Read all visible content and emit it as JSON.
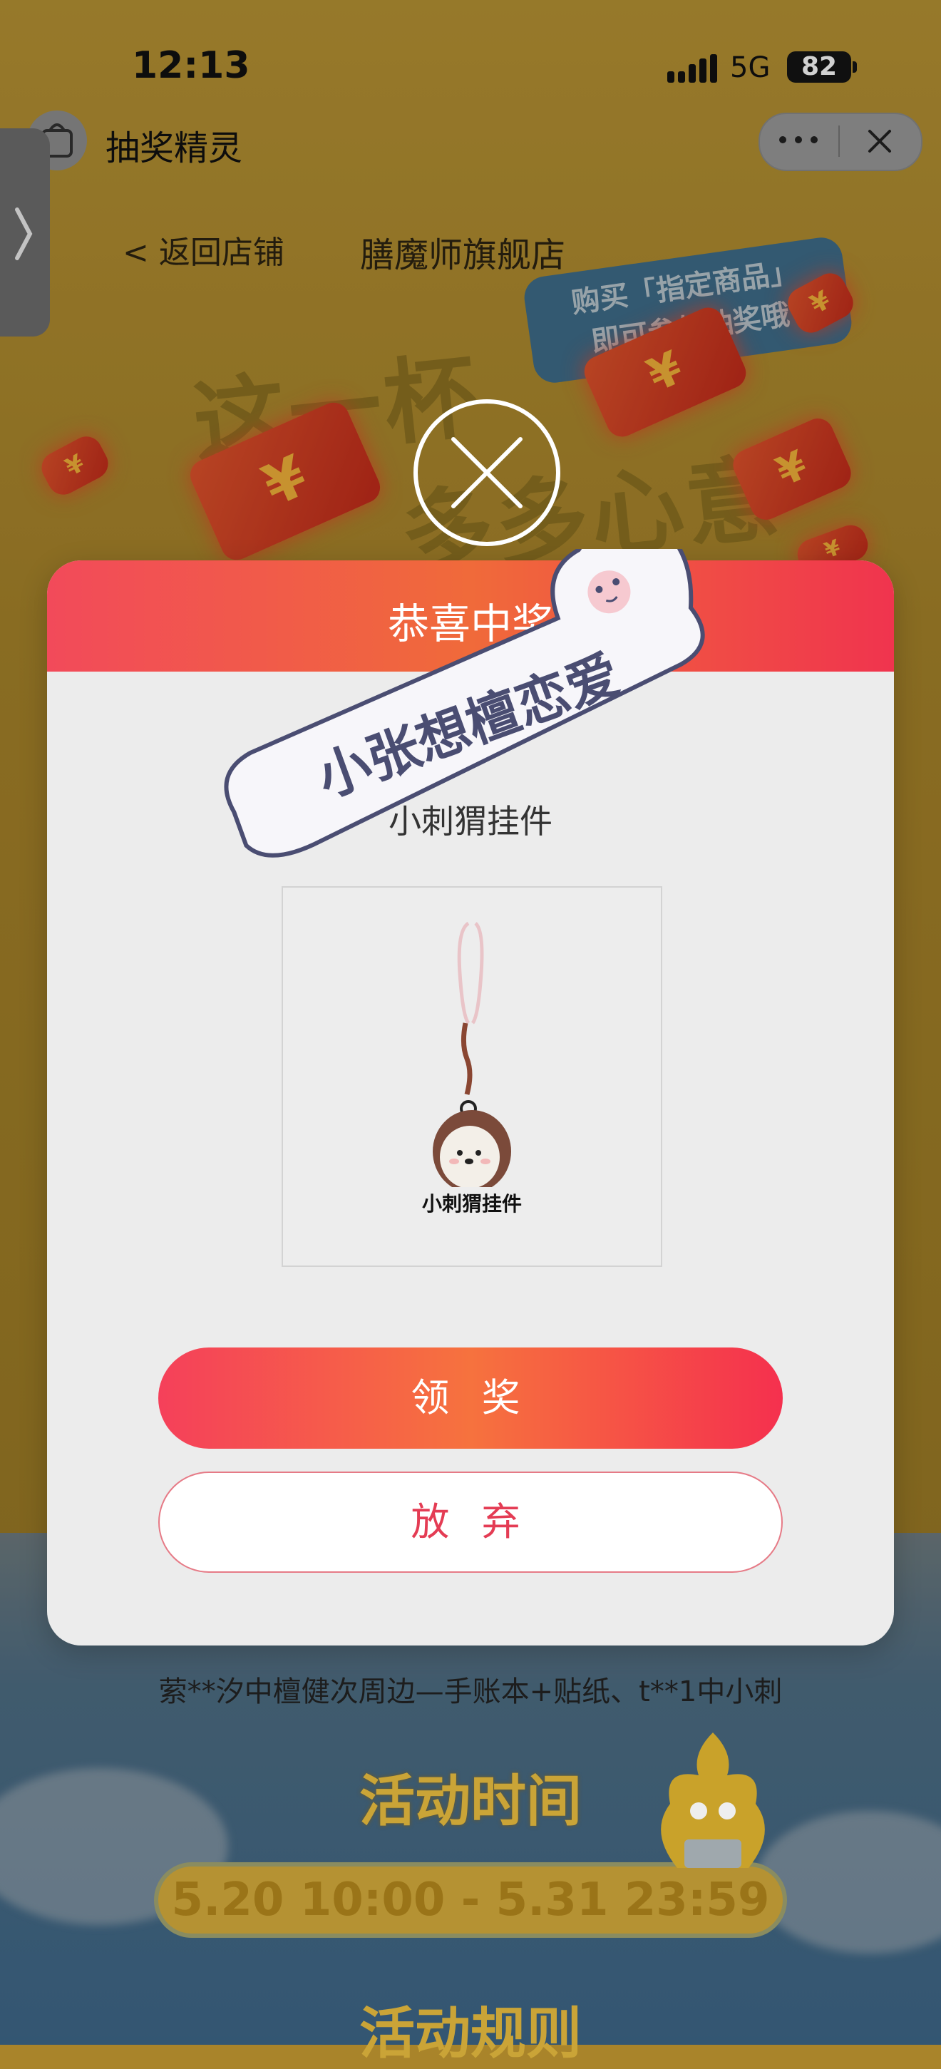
{
  "status_bar": {
    "time": "12:13",
    "network": "5G",
    "battery": "82"
  },
  "app": {
    "title": "抽奖精灵"
  },
  "nav": {
    "back_label": "< 返回店铺",
    "shop_name": "膳魔师旗舰店"
  },
  "promo": {
    "badge_line1": "购买「指定商品」",
    "badge_line2": "即可参与抽奖哦",
    "headline_1": "这一杯",
    "headline_2": "多多心意"
  },
  "modal": {
    "title": "恭喜中奖",
    "prize_caption": "小刺猬挂件",
    "prize_image_label": "小刺猬挂件",
    "claim_label": "领 奖",
    "give_up_label": "放 弃"
  },
  "watermark": {
    "text": "小张想檀恋爱"
  },
  "ticker": {
    "text": "萦**汐中檀健次周边—手账本+贴纸、t**1中小刺"
  },
  "activity": {
    "time_title": "活动时间",
    "time_range": "5.20 10:00 - 5.31 23:59",
    "rules_title": "活动规则"
  },
  "colors": {
    "brand_red": "#f24a5a",
    "accent_orange": "#f06a3a",
    "give_up_text": "#e43c54"
  }
}
